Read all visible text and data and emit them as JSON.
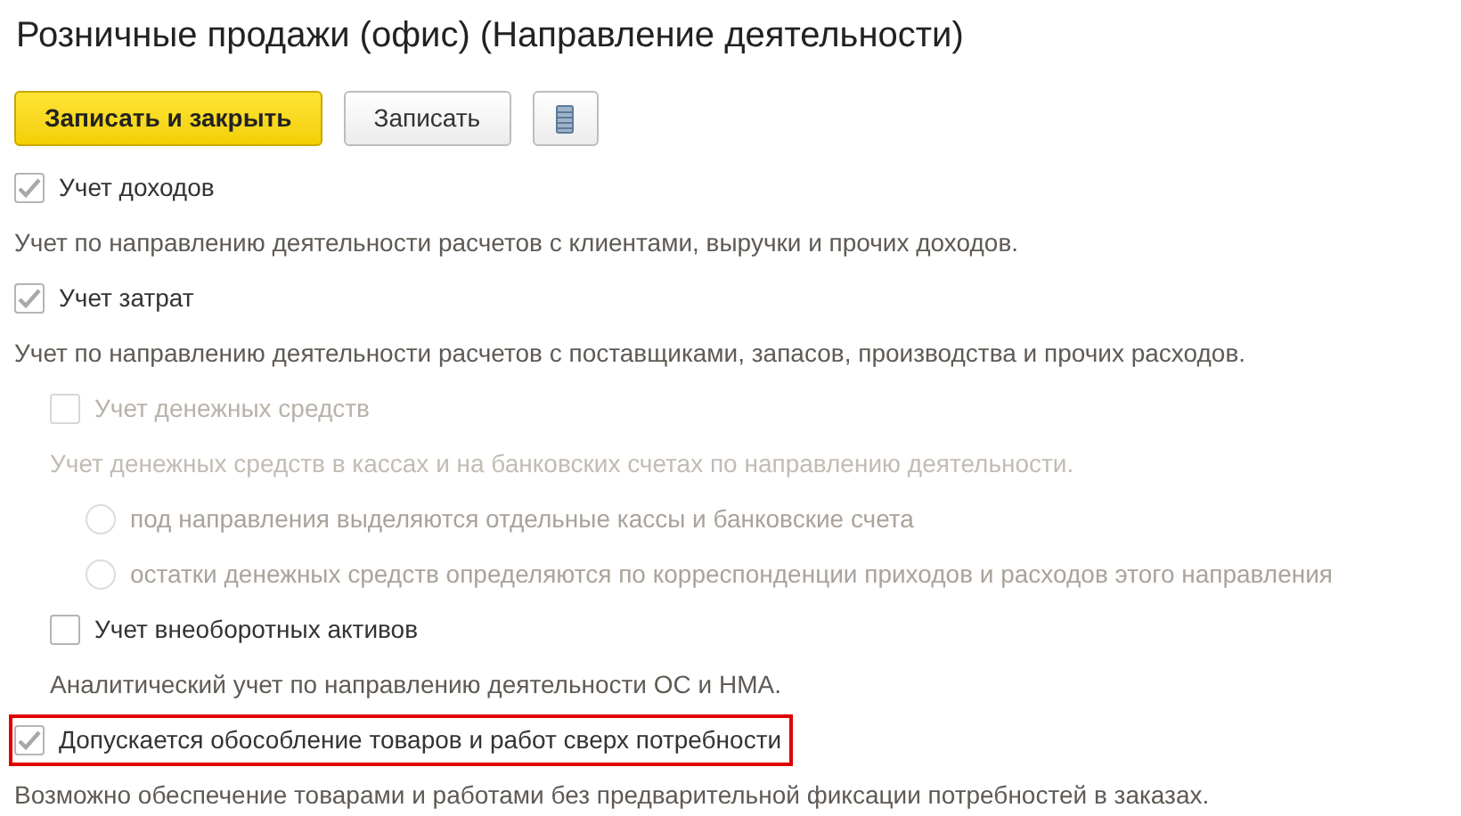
{
  "title": "Розничные продажи (офис) (Направление деятельности)",
  "buttons": [
    {
      "kind": "primary",
      "label": "Записать и закрыть"
    },
    {
      "kind": "secondary",
      "label": "Записать"
    },
    {
      "kind": "menu"
    }
  ],
  "options": [
    {
      "kind": "checkbox",
      "label": "Учет доходов",
      "checked": true,
      "disabled": false,
      "highlighted": false,
      "description": "Учет по направлению деятельности расчетов с клиентами, выручки и прочих доходов."
    },
    {
      "kind": "checkbox",
      "label": "Учет затрат",
      "checked": true,
      "disabled": false,
      "highlighted": false,
      "description": "Учет по направлению деятельности расчетов с поставщиками, запасов, производства и прочих расходов.",
      "children": [
        {
          "kind": "checkbox",
          "label": "Учет денежных средств",
          "checked": false,
          "disabled": true,
          "highlighted": false,
          "description": "Учет денежных средств в кассах и на банковских счетах по направлению деятельности.",
          "children": [
            {
              "kind": "radio",
              "label": "под направления выделяются отдельные кассы и банковские счета",
              "selected": false,
              "disabled": true
            },
            {
              "kind": "radio",
              "label": "остатки денежных средств определяются по корреспонденции приходов и расходов этого направления",
              "selected": false,
              "disabled": true
            }
          ]
        },
        {
          "kind": "checkbox",
          "label": "Учет внеоборотных активов",
          "checked": false,
          "disabled": false,
          "highlighted": false,
          "description": "Аналитический учет по направлению деятельности ОС и НМА."
        }
      ]
    },
    {
      "kind": "checkbox",
      "label": "Допускается обособление товаров и работ сверх потребности",
      "checked": true,
      "disabled": false,
      "highlighted": true,
      "description": "Возможно обеспечение товарами и работами без предварительной фиксации потребностей в заказах."
    }
  ]
}
